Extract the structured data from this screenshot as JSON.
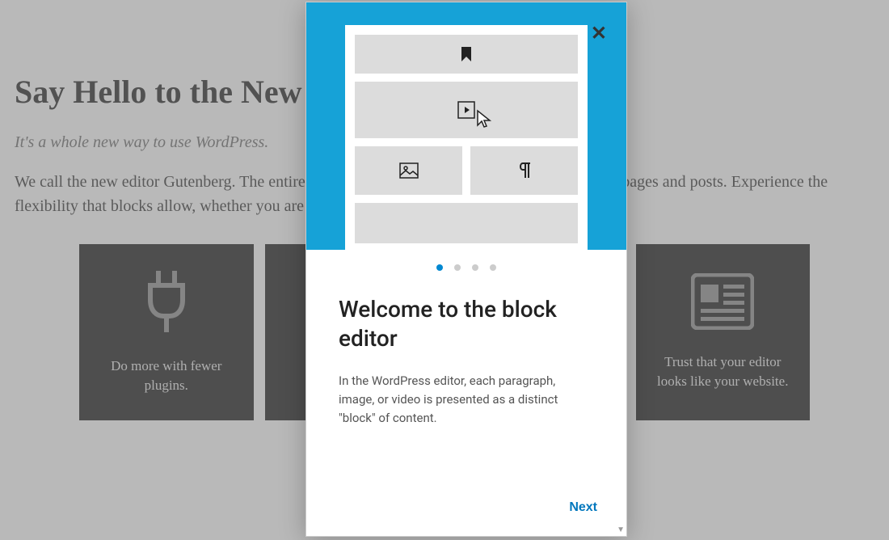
{
  "page": {
    "title": "Say Hello to the New Editor",
    "tagline": "It's a whole new way to use WordPress.",
    "description": "We call the new editor Gutenberg. The entire editing experience has been built for media rich pages and posts. Experience the flexibility that blocks allow, whether you are building your first site, or write code for a living."
  },
  "cards": [
    {
      "text": "Do more with fewer plugins."
    },
    {
      "text": ""
    },
    {
      "text": ""
    },
    {
      "text": "Trust that your editor looks like your website."
    }
  ],
  "modal": {
    "title": "Welcome to the block editor",
    "text": "In the WordPress editor, each paragraph, image, or video is presented as a distinct \"block\" of content.",
    "next": "Next",
    "close": "✕",
    "current_step": 1,
    "total_steps": 4
  }
}
